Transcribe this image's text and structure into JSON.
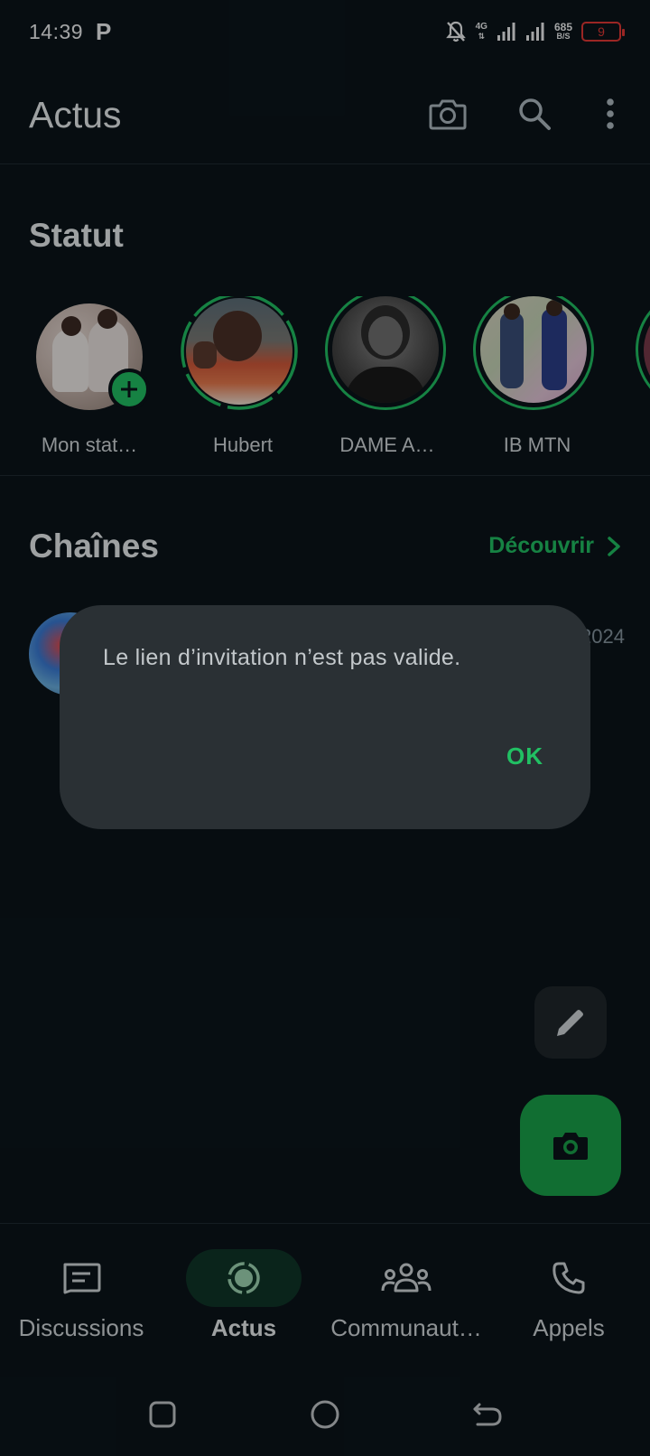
{
  "status_bar": {
    "time": "14:39",
    "carrier_icon": "P",
    "network_type": "4G",
    "data_rate_value": "685",
    "data_rate_unit": "B/S",
    "battery_level": "9"
  },
  "header": {
    "title": "Actus",
    "icons": [
      "camera-icon",
      "search-icon",
      "more-options-icon"
    ]
  },
  "status_section": {
    "title": "Statut",
    "stories": [
      {
        "name": "Mon stat…"
      },
      {
        "name": "Hubert"
      },
      {
        "name": "DAME A…"
      },
      {
        "name": "IB MTN"
      }
    ]
  },
  "channels_section": {
    "title": "Chaînes",
    "discover_label": "Découvrir",
    "channel_date_partial": "2024"
  },
  "dialog": {
    "message": "Le lien d’invitation n’est pas valide.",
    "ok_label": "OK"
  },
  "bottom_nav": {
    "items": [
      {
        "label": "Discussions",
        "icon": "chat-icon",
        "active": false
      },
      {
        "label": "Actus",
        "icon": "updates-icon",
        "active": true
      },
      {
        "label": "Communaut…",
        "icon": "communities-icon",
        "active": false
      },
      {
        "label": "Appels",
        "icon": "phone-icon",
        "active": false
      }
    ]
  },
  "colors": {
    "background": "#0b141a",
    "accent_green": "#21c063",
    "fab_green": "#1aa34a",
    "dialog_bg": "#2a3034",
    "battery_red": "#e53935"
  }
}
